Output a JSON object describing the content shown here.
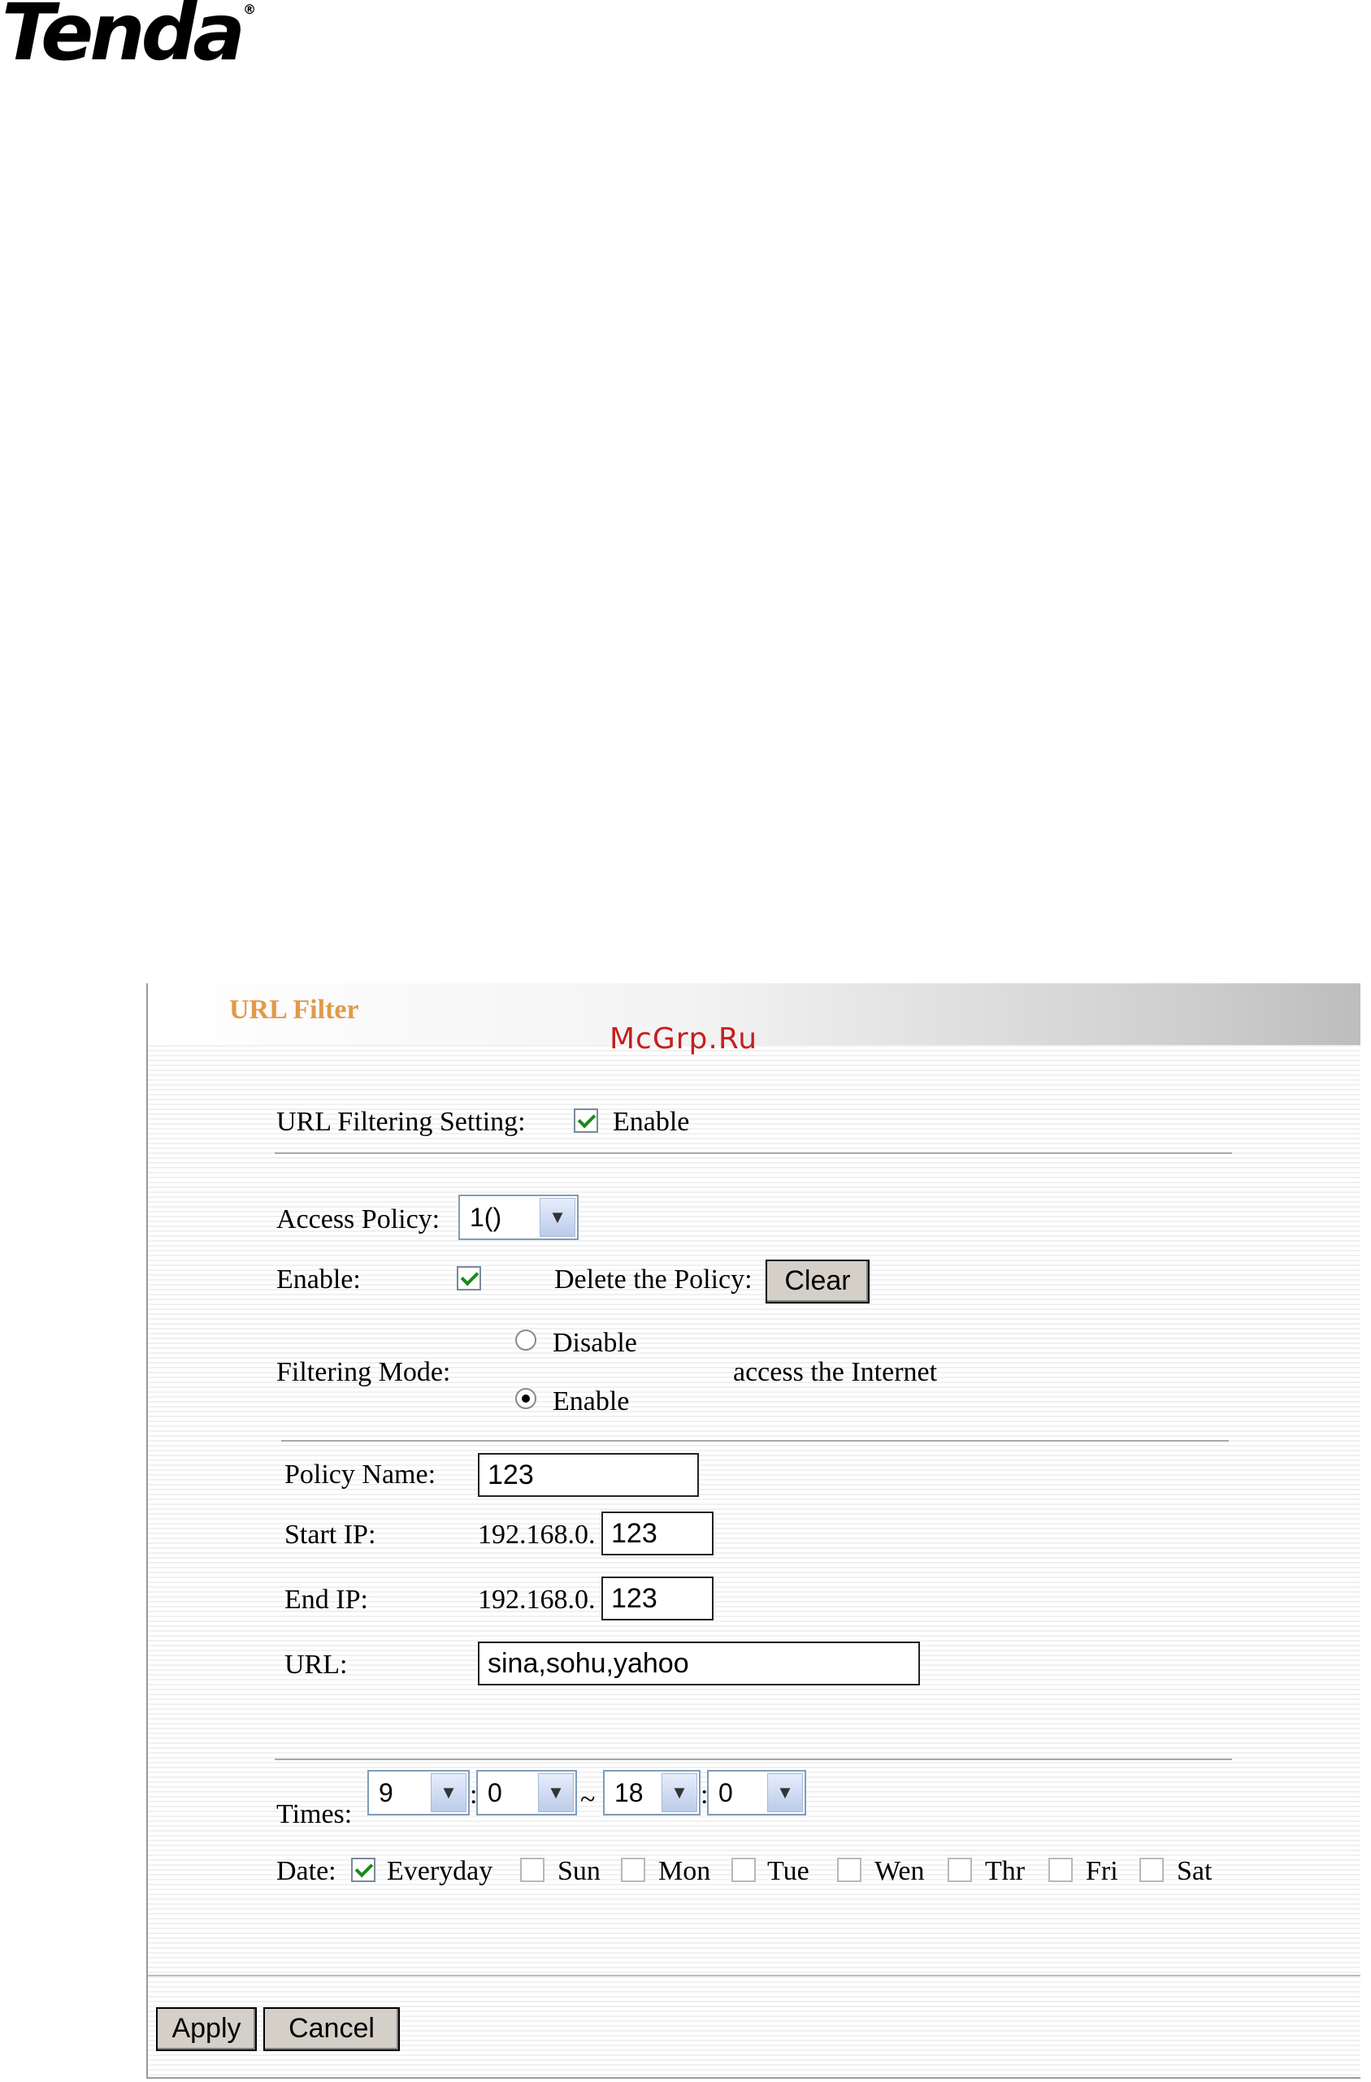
{
  "brand": {
    "logo_text": "Tenda",
    "reg_mark": "®"
  },
  "watermark": "McGrp.Ru",
  "panel": {
    "title": "URL Filter",
    "url_filtering": {
      "label": "URL Filtering Setting:",
      "checkbox_label": "Enable",
      "checked": true
    },
    "access_policy": {
      "label": "Access Policy:",
      "selected": "1()"
    },
    "enable": {
      "label": "Enable:",
      "checked": true
    },
    "delete_policy": {
      "label": "Delete the Policy:",
      "button": "Clear"
    },
    "filtering_mode": {
      "label": "Filtering Mode:",
      "options": [
        "Disable",
        "Enable"
      ],
      "selected": "Enable",
      "suffix": "access the Internet"
    },
    "policy_name": {
      "label": "Policy Name:",
      "value": "123"
    },
    "start_ip": {
      "label": "Start IP:",
      "prefix": "192.168.0.",
      "value": "123"
    },
    "end_ip": {
      "label": "End IP:",
      "prefix": "192.168.0.",
      "value": "123"
    },
    "url": {
      "label": "URL:",
      "value": "sina,sohu,yahoo"
    },
    "times": {
      "label": "Times:",
      "start_hour": "9",
      "start_min": "0",
      "end_hour": "18",
      "end_min": "0",
      "colon": ":",
      "tilde": "~"
    },
    "date": {
      "label": "Date:",
      "days": [
        {
          "label": "Everyday",
          "checked": true
        },
        {
          "label": "Sun",
          "checked": false
        },
        {
          "label": "Mon",
          "checked": false
        },
        {
          "label": "Tue",
          "checked": false
        },
        {
          "label": "Wen",
          "checked": false
        },
        {
          "label": "Thr",
          "checked": false
        },
        {
          "label": "Fri",
          "checked": false
        },
        {
          "label": "Sat",
          "checked": false
        }
      ]
    },
    "buttons": {
      "apply": "Apply",
      "cancel": "Cancel"
    }
  }
}
